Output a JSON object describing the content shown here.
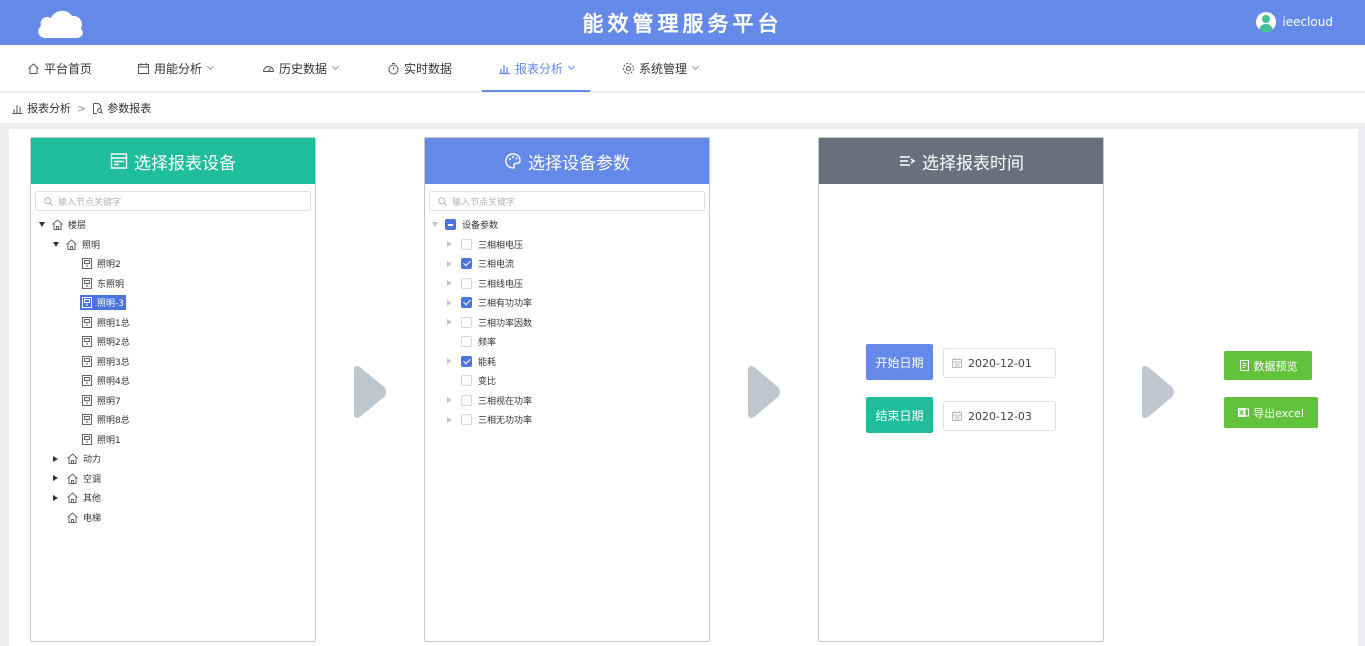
{
  "header": {
    "title": "能效管理服务平台",
    "username": "ieecloud"
  },
  "nav": [
    {
      "label": "平台首页",
      "icon": "home-icon",
      "dropdown": false,
      "active": false
    },
    {
      "label": "用能分析",
      "icon": "calendar-icon",
      "dropdown": true,
      "active": false
    },
    {
      "label": "历史数据",
      "icon": "gauge-icon",
      "dropdown": true,
      "active": false
    },
    {
      "label": "实时数据",
      "icon": "stopwatch-icon",
      "dropdown": false,
      "active": false
    },
    {
      "label": "报表分析",
      "icon": "bar-chart-icon",
      "dropdown": true,
      "active": true
    },
    {
      "label": "系统管理",
      "icon": "gear-icon",
      "dropdown": true,
      "active": false
    }
  ],
  "breadcrumb": {
    "first": "报表分析",
    "second": "参数报表"
  },
  "panel1": {
    "title": "选择报表设备",
    "search_placeholder": "输入节点关键字",
    "tree": {
      "root": "楼层",
      "group": "照明",
      "devices": [
        "照明2",
        "东照明",
        "照明-3",
        "照明1总",
        "照明2总",
        "照明3总",
        "照明4总",
        "照明7",
        "照明8总",
        "照明1"
      ],
      "selected_device": "照明-3",
      "siblings": [
        "动力",
        "空调",
        "其他",
        "电梯"
      ]
    }
  },
  "panel2": {
    "title": "选择设备参数",
    "search_placeholder": "输入节点关键字",
    "root": "设备参数",
    "params": [
      {
        "label": "三相相电压",
        "checked": false
      },
      {
        "label": "三相电流",
        "checked": true
      },
      {
        "label": "三相线电压",
        "checked": false
      },
      {
        "label": "三相有功功率",
        "checked": true
      },
      {
        "label": "三相功率因数",
        "checked": false
      },
      {
        "label": "频率",
        "checked": false
      },
      {
        "label": "能耗",
        "checked": true
      },
      {
        "label": "变比",
        "checked": false
      },
      {
        "label": "三相视在功率",
        "checked": false
      },
      {
        "label": "三相无功功率",
        "checked": false
      }
    ]
  },
  "panel3": {
    "title": "选择报表时间",
    "start_label": "开始日期",
    "start_value": "2020-12-01",
    "end_label": "结束日期",
    "end_value": "2020-12-03"
  },
  "actions": {
    "preview": "数据预览",
    "export": "导出excel"
  },
  "colors": {
    "header": "#6489e8",
    "green": "#1fbd9c",
    "grey": "#6b6f7d",
    "action": "#62c23b",
    "selected": "#4a74e0"
  }
}
